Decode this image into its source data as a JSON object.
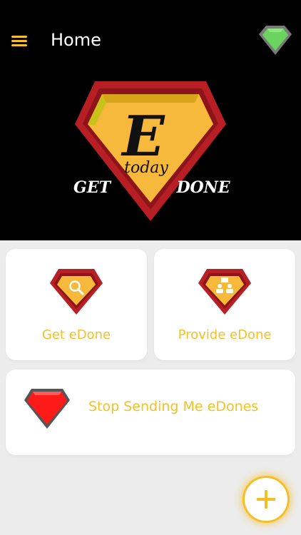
{
  "header": {
    "title": "Home",
    "menu_icon": "hamburger-icon",
    "action_icon": "green-gem-icon"
  },
  "hero": {
    "logo_letter": "E",
    "logo_script": "today",
    "logo_left": "GET",
    "logo_right": "DONE"
  },
  "cards": {
    "get": {
      "label": "Get eDone",
      "icon": "search-gem-icon"
    },
    "provide": {
      "label": "Provide eDone",
      "icon": "people-gem-icon"
    },
    "stop": {
      "label": "Stop Sending Me eDones",
      "icon": "red-gem-icon"
    }
  },
  "fab": {
    "icon": "plus-icon"
  },
  "colors": {
    "accent": "#f5c027",
    "gem_red": "#b81f24",
    "gem_gold": "#f6b93b",
    "gem_green": "#6bd35f",
    "stop_red": "#ff1a1a",
    "header_bg": "#000000",
    "page_bg": "#ececec"
  }
}
